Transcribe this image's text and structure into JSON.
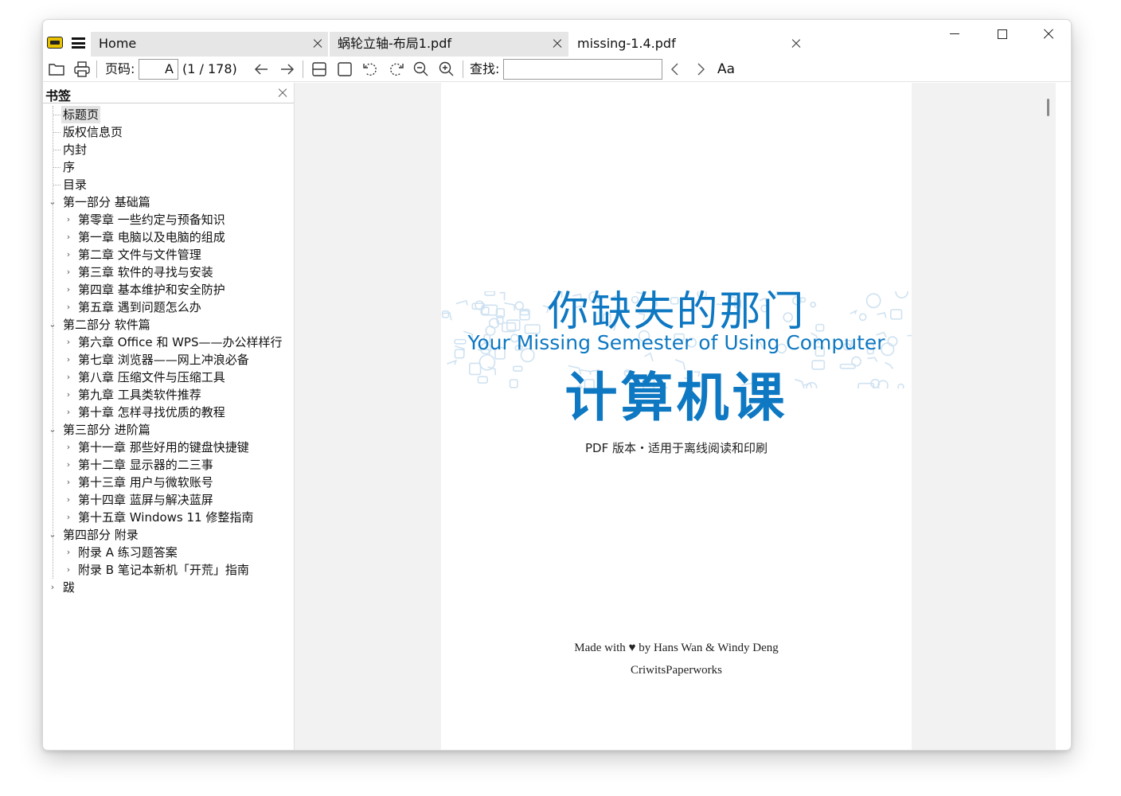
{
  "tabs": [
    {
      "label": "Home",
      "active": false
    },
    {
      "label": "蜗轮立轴-布局1.pdf",
      "active": false
    },
    {
      "label": "missing-1.4.pdf",
      "active": true
    }
  ],
  "toolbar": {
    "page_label": "页码:",
    "page_value": "A",
    "page_count": "(1 / 178)",
    "find_label": "查找:",
    "find_value": "",
    "font_toggle_label": "Aa"
  },
  "sidebar": {
    "title": "书签",
    "items": [
      {
        "label": "标题页",
        "level": 0,
        "expandable": false,
        "selected": true
      },
      {
        "label": "版权信息页",
        "level": 0,
        "expandable": false
      },
      {
        "label": "内封",
        "level": 0,
        "expandable": false
      },
      {
        "label": "序",
        "level": 0,
        "expandable": false
      },
      {
        "label": "目录",
        "level": 0,
        "expandable": false
      },
      {
        "label": "第一部分 基础篇",
        "level": 0,
        "expandable": true,
        "expanded": true
      },
      {
        "label": "第零章 一些约定与预备知识",
        "level": 1,
        "expandable": true
      },
      {
        "label": "第一章 电脑以及电脑的组成",
        "level": 1,
        "expandable": true
      },
      {
        "label": "第二章 文件与文件管理",
        "level": 1,
        "expandable": true
      },
      {
        "label": "第三章 软件的寻找与安装",
        "level": 1,
        "expandable": true
      },
      {
        "label": "第四章 基本维护和安全防护",
        "level": 1,
        "expandable": true
      },
      {
        "label": "第五章 遇到问题怎么办",
        "level": 1,
        "expandable": true
      },
      {
        "label": "第二部分 软件篇",
        "level": 0,
        "expandable": true,
        "expanded": true
      },
      {
        "label": "第六章 Office 和 WPS——办公样样行",
        "level": 1,
        "expandable": true
      },
      {
        "label": "第七章 浏览器——网上冲浪必备",
        "level": 1,
        "expandable": true
      },
      {
        "label": "第八章 压缩文件与压缩工具",
        "level": 1,
        "expandable": true
      },
      {
        "label": "第九章 工具类软件推荐",
        "level": 1,
        "expandable": true
      },
      {
        "label": "第十章 怎样寻找优质的教程",
        "level": 1,
        "expandable": true
      },
      {
        "label": "第三部分 进阶篇",
        "level": 0,
        "expandable": true,
        "expanded": true
      },
      {
        "label": "第十一章 那些好用的键盘快捷键",
        "level": 1,
        "expandable": true
      },
      {
        "label": "第十二章 显示器的二三事",
        "level": 1,
        "expandable": true
      },
      {
        "label": "第十三章 用户与微软账号",
        "level": 1,
        "expandable": true
      },
      {
        "label": "第十四章 蓝屏与解决蓝屏",
        "level": 1,
        "expandable": true
      },
      {
        "label": "第十五章 Windows 11 修整指南",
        "level": 1,
        "expandable": true
      },
      {
        "label": "第四部分 附录",
        "level": 0,
        "expandable": true,
        "expanded": true
      },
      {
        "label": "附录 A 练习题答案",
        "level": 1,
        "expandable": true
      },
      {
        "label": "附录 B 笔记本新机「开荒」指南",
        "level": 1,
        "expandable": true
      },
      {
        "label": "跋",
        "level": 0,
        "expandable": true,
        "expanded": false
      }
    ]
  },
  "document": {
    "title_cn_top": "你缺失的那门",
    "title_en": "Your Missing Semester of Using Computer",
    "title_cn_bottom": "计算机课",
    "subtitle": "PDF 版本・适用于离线阅读和印刷",
    "made_with_prefix": "Made with",
    "made_with_suffix": "by Hans Wan & Windy Deng",
    "publisher": "CriwitsPaperworks"
  },
  "colors": {
    "accent_blue": "#0e78c2",
    "doodle_blue": "#cfe2f1",
    "tab_inactive_bg": "#e6e6e6",
    "viewer_bg": "#f2f2f2"
  },
  "icons": [
    "app-logo-icon",
    "hamburger-menu-icon",
    "open-folder-icon",
    "print-icon",
    "back-arrow-icon",
    "forward-arrow-icon",
    "fit-width-icon",
    "fit-page-icon",
    "rotate-left-icon",
    "rotate-right-icon",
    "zoom-out-icon",
    "zoom-in-icon",
    "find-prev-icon",
    "find-next-icon",
    "match-case-icon",
    "heart-icon"
  ]
}
